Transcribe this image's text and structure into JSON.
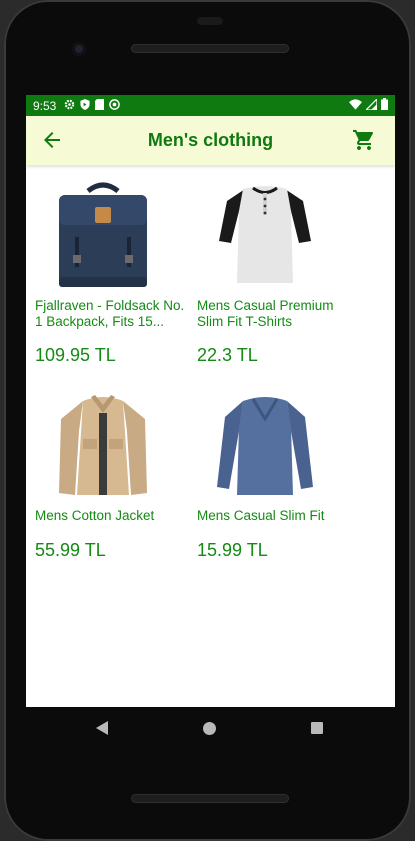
{
  "status": {
    "time": "9:53",
    "icons": [
      "gear-icon",
      "shield-icon",
      "sd-card-icon",
      "no-disturb-icon"
    ],
    "right_icons": [
      "wifi-icon",
      "signal-icon",
      "battery-icon"
    ]
  },
  "appbar": {
    "title": "Men's clothing",
    "back_icon": "arrow-left-icon",
    "cart_icon": "shopping-cart-icon"
  },
  "colors": {
    "status_bar": "#0f7a0f",
    "app_bar": "#f6fbd6",
    "accent_green": "#158a15"
  },
  "products": [
    {
      "name": "Fjallraven - Foldsack No. 1 Backpack, Fits 15...",
      "price": "109.95 TL",
      "image": "backpack-image"
    },
    {
      "name": "Mens Casual Premium Slim Fit T-Shirts",
      "price": "22.3 TL",
      "image": "raglan-tshirt-image"
    },
    {
      "name": "Mens Cotton Jacket",
      "price": "55.99 TL",
      "image": "cotton-jacket-image"
    },
    {
      "name": "Mens Casual Slim Fit",
      "price": "15.99 TL",
      "image": "longsleeve-shirt-image"
    }
  ],
  "nav": {
    "back": "nav-back-icon",
    "home": "nav-home-icon",
    "recents": "nav-recents-icon"
  }
}
